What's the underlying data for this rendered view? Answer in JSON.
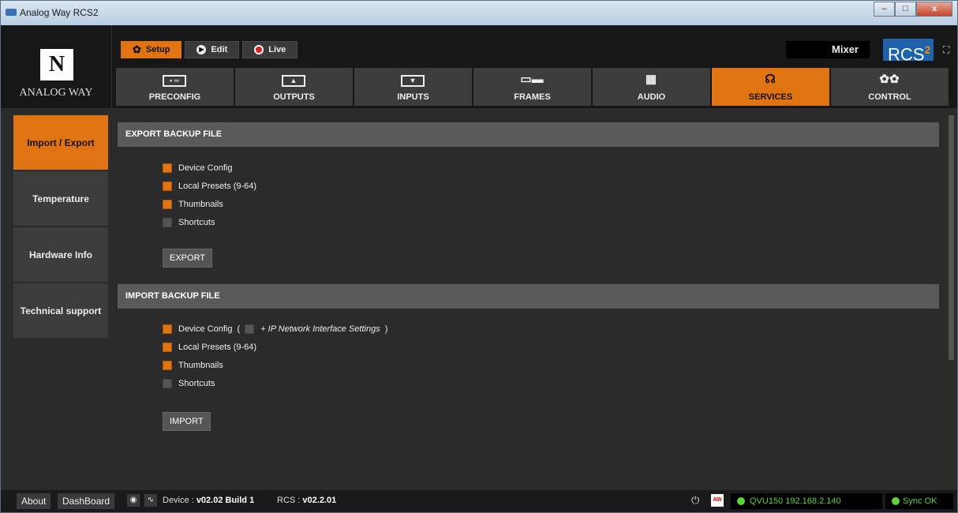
{
  "window": {
    "title": "Analog Way RCS2",
    "minimize": "–",
    "maximize": "□",
    "close": "x"
  },
  "brand": {
    "logo_text": "ANALOG WAY",
    "rcs_logo": "RCS",
    "rcs_version_sup": "2"
  },
  "modes": [
    {
      "label": "Setup",
      "icon": "gear-icon",
      "active": true
    },
    {
      "label": "Edit",
      "icon": "play-icon",
      "active": false
    },
    {
      "label": "Live",
      "icon": "record-icon",
      "active": false
    }
  ],
  "mixer_label": "Mixer",
  "nav_tabs": [
    {
      "label": "PRECONFIG",
      "icon": "preconfig-icon"
    },
    {
      "label": "OUTPUTS",
      "icon": "outputs-icon"
    },
    {
      "label": "INPUTS",
      "icon": "inputs-icon"
    },
    {
      "label": "FRAMES",
      "icon": "frames-icon"
    },
    {
      "label": "AUDIO",
      "icon": "audio-icon"
    },
    {
      "label": "SERVICES",
      "icon": "services-icon",
      "active": true
    },
    {
      "label": "CONTROL",
      "icon": "control-gears-icon"
    }
  ],
  "sidebar": [
    {
      "label": "Import / Export",
      "active": true
    },
    {
      "label": "Temperature"
    },
    {
      "label": "Hardware Info"
    },
    {
      "label": "Technical support"
    }
  ],
  "export": {
    "header": "EXPORT BACKUP FILE",
    "options": [
      {
        "label": "Device Config",
        "checked": true
      },
      {
        "label": "Local Presets (9-64)",
        "checked": true
      },
      {
        "label": "Thumbnails",
        "checked": true
      },
      {
        "label": "Shortcuts",
        "checked": false
      }
    ],
    "button": "EXPORT"
  },
  "import": {
    "header": "IMPORT BACKUP FILE",
    "options": [
      {
        "label": "Device Config",
        "checked": true,
        "paren_open": "(",
        "paren_close": ")",
        "ip_label": "+ IP Network Interface Settings",
        "ip_checked": false
      },
      {
        "label": "Local Presets (9-64)",
        "checked": true
      },
      {
        "label": "Thumbnails",
        "checked": true
      },
      {
        "label": "Shortcuts",
        "checked": false
      }
    ],
    "button": "IMPORT"
  },
  "statusbar": {
    "about": "About",
    "dashboard": "DashBoard",
    "device_label": "Device :",
    "device_version": "v02.02 Build 1",
    "rcs_label": "RCS :",
    "rcs_version": "v02.2.01",
    "aw_badge": "AW",
    "device_status": "QVU150  192.168.2.140",
    "sync_status": "Sync OK"
  },
  "colors": {
    "accent": "#e07312",
    "status_green": "#5fd23b"
  }
}
